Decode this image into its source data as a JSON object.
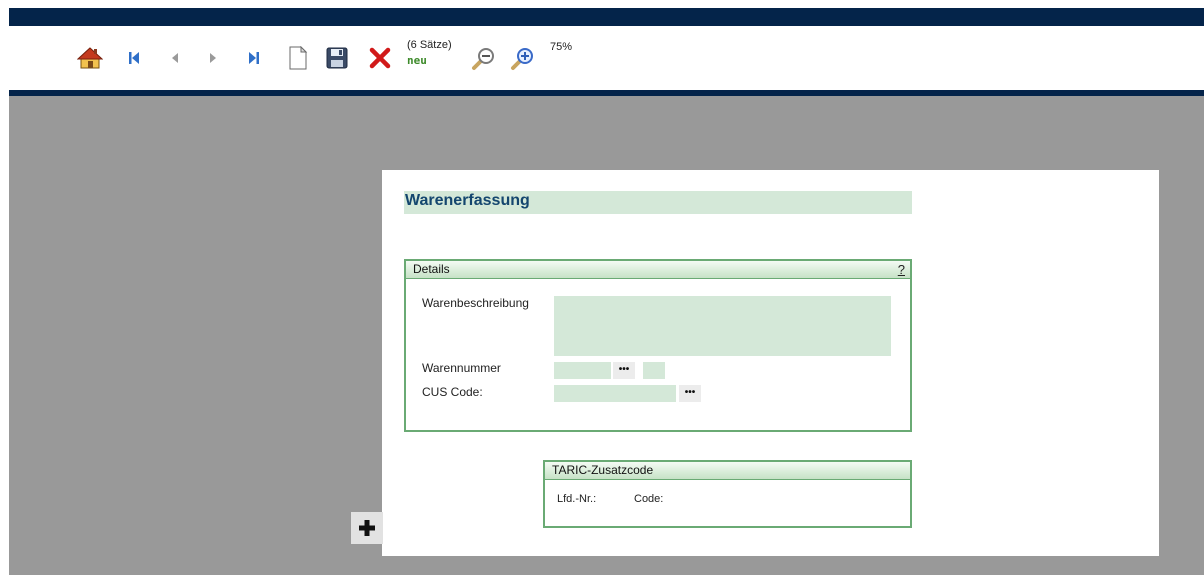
{
  "toolbar": {
    "record_count": "(6 Sätze)",
    "record_state": "neu",
    "zoom_level": "75%"
  },
  "form": {
    "title": "Warenerfassung"
  },
  "details_panel": {
    "header": "Details",
    "help": "?",
    "warenbeschreibung_label": "Warenbeschreibung",
    "warenbeschreibung_value": "",
    "warennummer_label": "Warennummer",
    "warennummer_value": "",
    "warennummer_suffix_value": "",
    "cus_code_label": "CUS Code:",
    "cus_code_value": "",
    "lookup_label": "•••"
  },
  "taric_panel": {
    "header": "TARIC-Zusatzcode",
    "lfd_nr_label": "Lfd.-Nr.:",
    "code_label": "Code:"
  },
  "colors": {
    "header_bar": "#04244a",
    "workarea": "#999999",
    "field_bg": "#d4e8d8",
    "title_text": "#14466e",
    "panel_border": "#6aaa74"
  }
}
